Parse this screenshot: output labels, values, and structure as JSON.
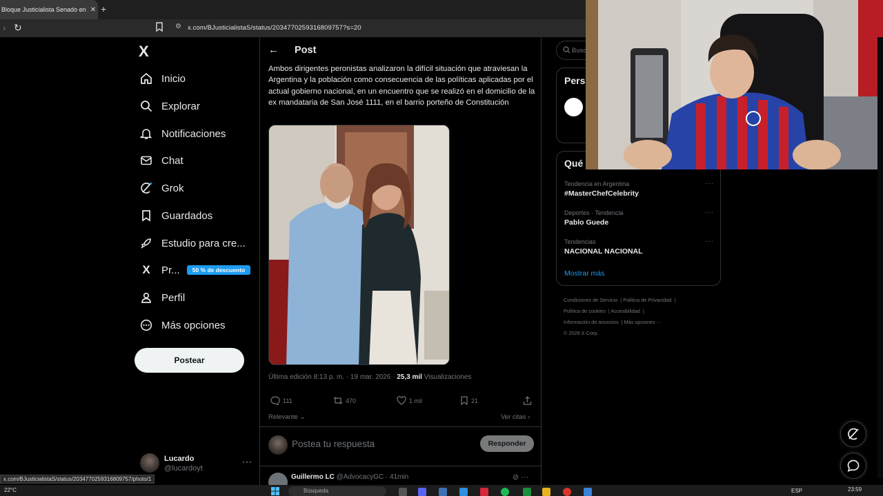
{
  "browser": {
    "tab_title": "Bloque Justicialista Senado en X",
    "tab_close": "✕",
    "new_tab": "+",
    "url": "x.com/BJusticialistaS/status/2034770259316809757?s=20",
    "status_url": "x.com/BJusticialistaS/status/2034770259316809757/photo/1"
  },
  "nav": {
    "logo": "X",
    "items": [
      {
        "label": "Inicio",
        "icon": "home-icon"
      },
      {
        "label": "Explorar",
        "icon": "search-icon"
      },
      {
        "label": "Notificaciones",
        "icon": "bell-icon"
      },
      {
        "label": "Chat",
        "icon": "mail-icon"
      },
      {
        "label": "Grok",
        "icon": "grok-icon"
      },
      {
        "label": "Guardados",
        "icon": "bookmark-icon"
      },
      {
        "label": "Estudio para cre...",
        "icon": "rocket-icon"
      },
      {
        "label": "Pr...",
        "icon": "x-premium-icon"
      },
      {
        "label": "Perfil",
        "icon": "person-icon"
      },
      {
        "label": "Más opciones",
        "icon": "more-circle-icon"
      }
    ],
    "promo_badge": "50 % de descuento",
    "post_button": "Postear",
    "account": {
      "name": "Lucardo",
      "handle": "@lucardoyt",
      "more": "···"
    }
  },
  "post": {
    "header": "Post",
    "text": "Ambos dirigentes peronistas analizaron la difícil situación que atraviesan la Argentina y la población como consecuencia de las políticas aplicadas por el actual gobierno nacional, en un encuentro que se realizó en el domicilio de la ex mandataria de San José 1111, en el barrio porteño de Constitución",
    "edit_prefix": "Última edición 8:13 p. m. · 19 mar. 2026 · ",
    "views_count": "25,3 mil",
    "views_label": " Visualizaciones",
    "actions": {
      "replies": "111",
      "reposts": "470",
      "likes": "1 mil",
      "bookmarks": "21"
    },
    "sort_label": "Relevante",
    "quotes_label": "Ver citas",
    "reply_placeholder": "Postea tu respuesta",
    "reply_button": "Responder",
    "comment": {
      "name": "Guillermo LC",
      "handle": "@AdvocacyGC",
      "time": " · 41min"
    }
  },
  "sidebar": {
    "search_placeholder": "Busc",
    "people_title": "Pers",
    "trends_title": "Qué",
    "trends": [
      {
        "meta": "Tendencia en Argentina",
        "name": "#MasterChefCelebrity"
      },
      {
        "meta": "Deportes · Tendencia",
        "name": "Pablo Guede"
      },
      {
        "meta": "Tendencias",
        "name": "NACIONAL NACIONAL"
      }
    ],
    "show_more": "Mostrar más",
    "footer": [
      "Condiciones de Servicio",
      "Política de Privacidad",
      "Política de cookies",
      "Accesibilidad",
      "Información de anuncios",
      "Más opciones ···",
      "© 2026 X Corp."
    ]
  },
  "taskbar": {
    "temperature": "22°C",
    "search": "Búsqueda",
    "lang": "ESP",
    "time": "23:59"
  },
  "colors": {
    "accent": "#1d9bf0",
    "background": "#000000",
    "border": "#2f3336",
    "muted": "#71767b"
  }
}
